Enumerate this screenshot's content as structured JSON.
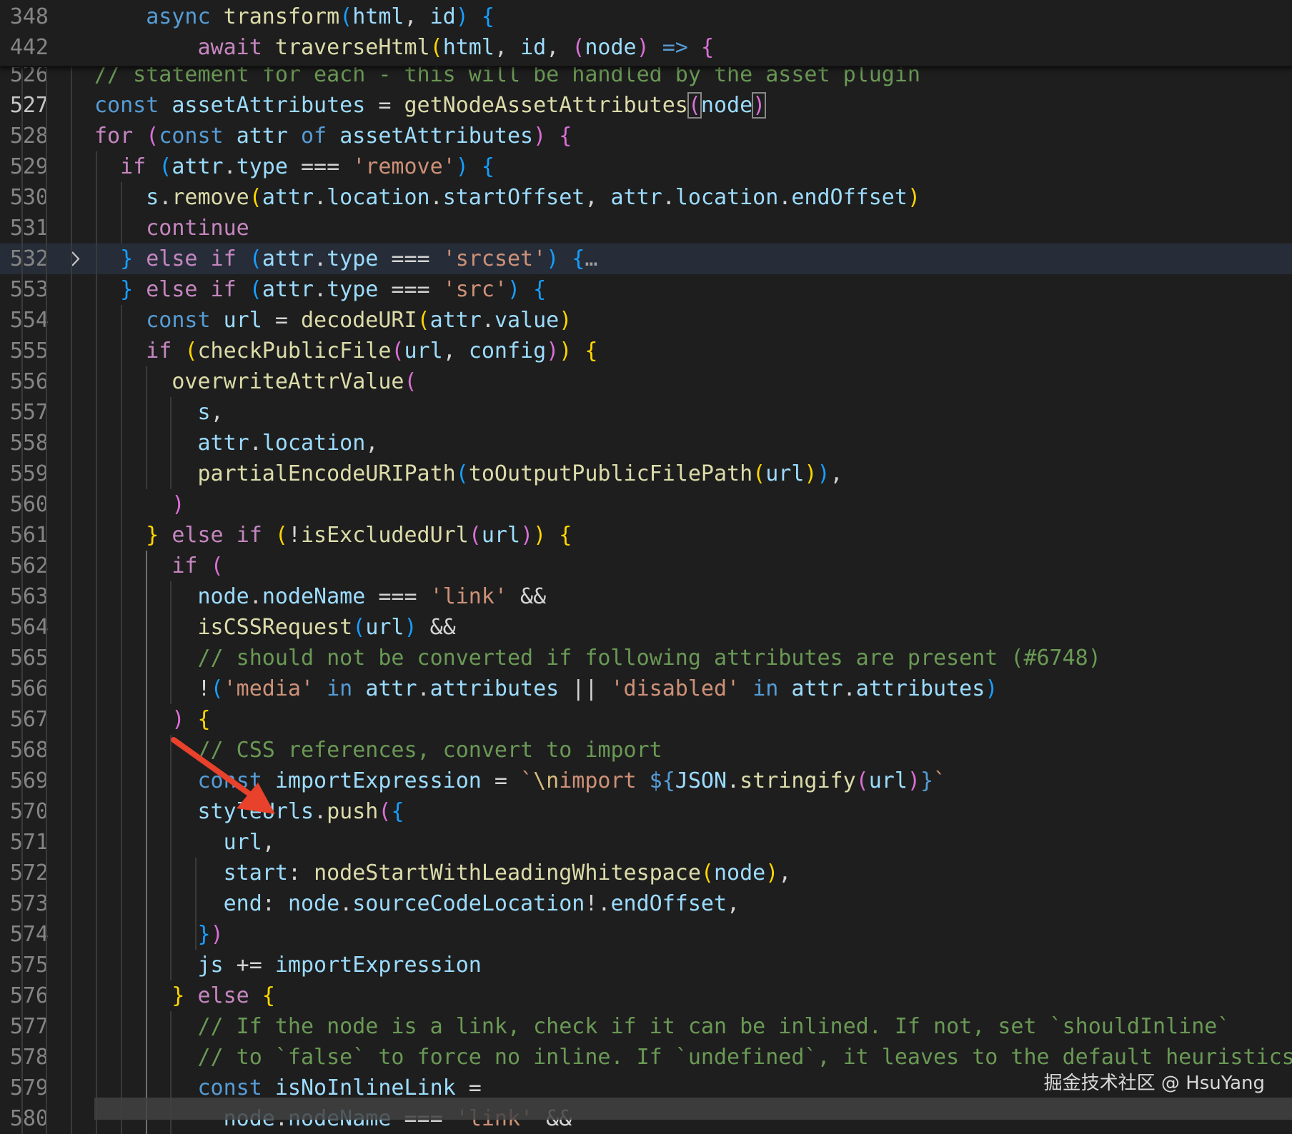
{
  "sticky": [
    {
      "ln": "348",
      "tokens": [
        [
          "    ",
          "op"
        ],
        [
          "async",
          "kw"
        ],
        [
          " ",
          "op"
        ],
        [
          "transform",
          "fn"
        ],
        [
          "(",
          "br3"
        ],
        [
          "html",
          "var"
        ],
        [
          ", ",
          "op"
        ],
        [
          "id",
          "var"
        ],
        [
          ")",
          "br3"
        ],
        [
          " ",
          "op"
        ],
        [
          "{",
          "br3"
        ]
      ]
    },
    {
      "ln": "442",
      "tokens": [
        [
          "        ",
          "op"
        ],
        [
          "await",
          "ctl"
        ],
        [
          " ",
          "op"
        ],
        [
          "traverseHtml",
          "fn"
        ],
        [
          "(",
          "br1"
        ],
        [
          "html",
          "var"
        ],
        [
          ", ",
          "op"
        ],
        [
          "id",
          "var"
        ],
        [
          ", ",
          "op"
        ],
        [
          "(",
          "br2"
        ],
        [
          "node",
          "var"
        ],
        [
          ")",
          "br2"
        ],
        [
          " ",
          "op"
        ],
        [
          "=>",
          "kw"
        ],
        [
          " ",
          "op"
        ],
        [
          "{",
          "br2"
        ]
      ]
    }
  ],
  "lines": [
    {
      "ln": "526",
      "tokens": [
        [
          "// statement for each - this will be handled by the asset plugin",
          "cmt"
        ]
      ]
    },
    {
      "ln": "527",
      "active": true,
      "tokens": [
        [
          "const",
          "kw"
        ],
        [
          " ",
          "op"
        ],
        [
          "assetAttributes",
          "var"
        ],
        [
          " = ",
          "op"
        ],
        [
          "getNodeAssetAttributes",
          "fn"
        ],
        [
          "(",
          "br2",
          "box"
        ],
        [
          "node",
          "var"
        ],
        [
          ")",
          "br2",
          "box"
        ]
      ]
    },
    {
      "ln": "528",
      "tokens": [
        [
          "for",
          "ctl"
        ],
        [
          " ",
          "op"
        ],
        [
          "(",
          "br2"
        ],
        [
          "const",
          "kw"
        ],
        [
          " ",
          "op"
        ],
        [
          "attr",
          "var"
        ],
        [
          " ",
          "op"
        ],
        [
          "of",
          "kw"
        ],
        [
          " ",
          "op"
        ],
        [
          "assetAttributes",
          "var"
        ],
        [
          ")",
          "br2"
        ],
        [
          " ",
          "op"
        ],
        [
          "{",
          "br2"
        ]
      ]
    },
    {
      "ln": "529",
      "tokens": [
        [
          "  ",
          "op"
        ],
        [
          "if",
          "ctl"
        ],
        [
          " ",
          "op"
        ],
        [
          "(",
          "br3"
        ],
        [
          "attr",
          "var"
        ],
        [
          ".",
          "op"
        ],
        [
          "type",
          "var"
        ],
        [
          " === ",
          "op"
        ],
        [
          "'remove'",
          "str"
        ],
        [
          ")",
          "br3"
        ],
        [
          " ",
          "op"
        ],
        [
          "{",
          "br3"
        ]
      ]
    },
    {
      "ln": "530",
      "tokens": [
        [
          "    ",
          "op"
        ],
        [
          "s",
          "var"
        ],
        [
          ".",
          "op"
        ],
        [
          "remove",
          "fn"
        ],
        [
          "(",
          "br1"
        ],
        [
          "attr",
          "var"
        ],
        [
          ".",
          "op"
        ],
        [
          "location",
          "var"
        ],
        [
          ".",
          "op"
        ],
        [
          "startOffset",
          "var"
        ],
        [
          ", ",
          "op"
        ],
        [
          "attr",
          "var"
        ],
        [
          ".",
          "op"
        ],
        [
          "location",
          "var"
        ],
        [
          ".",
          "op"
        ],
        [
          "endOffset",
          "var"
        ],
        [
          ")",
          "br1"
        ]
      ]
    },
    {
      "ln": "531",
      "tokens": [
        [
          "    ",
          "op"
        ],
        [
          "continue",
          "ctl"
        ]
      ]
    },
    {
      "ln": "532",
      "folded": true,
      "tokens": [
        [
          "  ",
          "op"
        ],
        [
          "}",
          "br3"
        ],
        [
          " ",
          "op"
        ],
        [
          "else",
          "ctl"
        ],
        [
          " ",
          "op"
        ],
        [
          "if",
          "ctl"
        ],
        [
          " ",
          "op"
        ],
        [
          "(",
          "br3"
        ],
        [
          "attr",
          "var"
        ],
        [
          ".",
          "op"
        ],
        [
          "type",
          "var"
        ],
        [
          " === ",
          "op"
        ],
        [
          "'srcset'",
          "str"
        ],
        [
          ")",
          "br3"
        ],
        [
          " ",
          "op"
        ],
        [
          "{",
          "br3"
        ],
        [
          "…",
          "ell"
        ]
      ]
    },
    {
      "ln": "553",
      "tokens": [
        [
          "  ",
          "op"
        ],
        [
          "}",
          "br3"
        ],
        [
          " ",
          "op"
        ],
        [
          "else",
          "ctl"
        ],
        [
          " ",
          "op"
        ],
        [
          "if",
          "ctl"
        ],
        [
          " ",
          "op"
        ],
        [
          "(",
          "br3"
        ],
        [
          "attr",
          "var"
        ],
        [
          ".",
          "op"
        ],
        [
          "type",
          "var"
        ],
        [
          " === ",
          "op"
        ],
        [
          "'src'",
          "str"
        ],
        [
          ")",
          "br3"
        ],
        [
          " ",
          "op"
        ],
        [
          "{",
          "br3"
        ]
      ]
    },
    {
      "ln": "554",
      "tokens": [
        [
          "    ",
          "op"
        ],
        [
          "const",
          "kw"
        ],
        [
          " ",
          "op"
        ],
        [
          "url",
          "var"
        ],
        [
          " = ",
          "op"
        ],
        [
          "decodeURI",
          "fn"
        ],
        [
          "(",
          "br1"
        ],
        [
          "attr",
          "var"
        ],
        [
          ".",
          "op"
        ],
        [
          "value",
          "var"
        ],
        [
          ")",
          "br1"
        ]
      ]
    },
    {
      "ln": "555",
      "tokens": [
        [
          "    ",
          "op"
        ],
        [
          "if",
          "ctl"
        ],
        [
          " ",
          "op"
        ],
        [
          "(",
          "br1"
        ],
        [
          "checkPublicFile",
          "fn"
        ],
        [
          "(",
          "br2"
        ],
        [
          "url",
          "var"
        ],
        [
          ", ",
          "op"
        ],
        [
          "config",
          "var"
        ],
        [
          ")",
          "br2"
        ],
        [
          ")",
          "br1"
        ],
        [
          " ",
          "op"
        ],
        [
          "{",
          "br1"
        ]
      ]
    },
    {
      "ln": "556",
      "tokens": [
        [
          "      ",
          "op"
        ],
        [
          "overwriteAttrValue",
          "fn"
        ],
        [
          "(",
          "br2"
        ]
      ]
    },
    {
      "ln": "557",
      "tokens": [
        [
          "        ",
          "op"
        ],
        [
          "s",
          "var"
        ],
        [
          ",",
          "op"
        ]
      ]
    },
    {
      "ln": "558",
      "tokens": [
        [
          "        ",
          "op"
        ],
        [
          "attr",
          "var"
        ],
        [
          ".",
          "op"
        ],
        [
          "location",
          "var"
        ],
        [
          ",",
          "op"
        ]
      ]
    },
    {
      "ln": "559",
      "tokens": [
        [
          "        ",
          "op"
        ],
        [
          "partialEncodeURIPath",
          "fn"
        ],
        [
          "(",
          "br3"
        ],
        [
          "toOutputPublicFilePath",
          "fn"
        ],
        [
          "(",
          "br1"
        ],
        [
          "url",
          "var"
        ],
        [
          ")",
          "br1"
        ],
        [
          ")",
          "br3"
        ],
        [
          ",",
          "op"
        ]
      ]
    },
    {
      "ln": "560",
      "tokens": [
        [
          "      ",
          "op"
        ],
        [
          ")",
          "br2"
        ]
      ]
    },
    {
      "ln": "561",
      "tokens": [
        [
          "    ",
          "op"
        ],
        [
          "}",
          "br1"
        ],
        [
          " ",
          "op"
        ],
        [
          "else",
          "ctl"
        ],
        [
          " ",
          "op"
        ],
        [
          "if",
          "ctl"
        ],
        [
          " ",
          "op"
        ],
        [
          "(",
          "br1"
        ],
        [
          "!",
          "op"
        ],
        [
          "isExcludedUrl",
          "fn"
        ],
        [
          "(",
          "br2"
        ],
        [
          "url",
          "var"
        ],
        [
          ")",
          "br2"
        ],
        [
          ")",
          "br1"
        ],
        [
          " ",
          "op"
        ],
        [
          "{",
          "br1"
        ]
      ]
    },
    {
      "ln": "562",
      "tokens": [
        [
          "      ",
          "op"
        ],
        [
          "if",
          "ctl"
        ],
        [
          " ",
          "op"
        ],
        [
          "(",
          "br2"
        ]
      ]
    },
    {
      "ln": "563",
      "tokens": [
        [
          "        ",
          "op"
        ],
        [
          "node",
          "var"
        ],
        [
          ".",
          "op"
        ],
        [
          "nodeName",
          "var"
        ],
        [
          " === ",
          "op"
        ],
        [
          "'link'",
          "str"
        ],
        [
          " &&",
          "op"
        ]
      ]
    },
    {
      "ln": "564",
      "tokens": [
        [
          "        ",
          "op"
        ],
        [
          "isCSSRequest",
          "fn"
        ],
        [
          "(",
          "br3"
        ],
        [
          "url",
          "var"
        ],
        [
          ")",
          "br3"
        ],
        [
          " &&",
          "op"
        ]
      ]
    },
    {
      "ln": "565",
      "tokens": [
        [
          "        ",
          "op"
        ],
        [
          "// should not be converted if following attributes are present (#6748)",
          "cmt"
        ]
      ]
    },
    {
      "ln": "566",
      "tokens": [
        [
          "        ",
          "op"
        ],
        [
          "!",
          "op"
        ],
        [
          "(",
          "br3"
        ],
        [
          "'media'",
          "str"
        ],
        [
          " ",
          "op"
        ],
        [
          "in",
          "kw"
        ],
        [
          " ",
          "op"
        ],
        [
          "attr",
          "var"
        ],
        [
          ".",
          "op"
        ],
        [
          "attributes",
          "var"
        ],
        [
          " || ",
          "op"
        ],
        [
          "'disabled'",
          "str"
        ],
        [
          " ",
          "op"
        ],
        [
          "in",
          "kw"
        ],
        [
          " ",
          "op"
        ],
        [
          "attr",
          "var"
        ],
        [
          ".",
          "op"
        ],
        [
          "attributes",
          "var"
        ],
        [
          ")",
          "br3"
        ]
      ]
    },
    {
      "ln": "567",
      "tokens": [
        [
          "      ",
          "op"
        ],
        [
          ")",
          "br2"
        ],
        [
          " ",
          "op"
        ],
        [
          "{",
          "br1"
        ]
      ]
    },
    {
      "ln": "568",
      "tokens": [
        [
          "        ",
          "op"
        ],
        [
          "// CSS references, convert to import",
          "cmt"
        ]
      ]
    },
    {
      "ln": "569",
      "tokens": [
        [
          "        ",
          "op"
        ],
        [
          "const",
          "kw"
        ],
        [
          " ",
          "op"
        ],
        [
          "importExpression",
          "var"
        ],
        [
          " = ",
          "op"
        ],
        [
          "`",
          "str"
        ],
        [
          "\\n",
          "esc"
        ],
        [
          "import ",
          "str"
        ],
        [
          "${",
          "kw"
        ],
        [
          "JSON",
          "var"
        ],
        [
          ".",
          "op"
        ],
        [
          "stringify",
          "fn"
        ],
        [
          "(",
          "br2"
        ],
        [
          "url",
          "var"
        ],
        [
          ")",
          "br2"
        ],
        [
          "}",
          "kw"
        ],
        [
          "`",
          "str"
        ]
      ]
    },
    {
      "ln": "570",
      "tokens": [
        [
          "        ",
          "op"
        ],
        [
          "styleUrls",
          "var"
        ],
        [
          ".",
          "op"
        ],
        [
          "push",
          "fn"
        ],
        [
          "(",
          "br2"
        ],
        [
          "{",
          "br3"
        ]
      ]
    },
    {
      "ln": "571",
      "tokens": [
        [
          "          ",
          "op"
        ],
        [
          "url",
          "var"
        ],
        [
          ",",
          "op"
        ]
      ]
    },
    {
      "ln": "572",
      "tokens": [
        [
          "          ",
          "op"
        ],
        [
          "start",
          "var"
        ],
        [
          ": ",
          "op"
        ],
        [
          "nodeStartWithLeadingWhitespace",
          "fn"
        ],
        [
          "(",
          "br1"
        ],
        [
          "node",
          "var"
        ],
        [
          ")",
          "br1"
        ],
        [
          ",",
          "op"
        ]
      ]
    },
    {
      "ln": "573",
      "tokens": [
        [
          "          ",
          "op"
        ],
        [
          "end",
          "var"
        ],
        [
          ": ",
          "op"
        ],
        [
          "node",
          "var"
        ],
        [
          ".",
          "op"
        ],
        [
          "sourceCodeLocation",
          "var"
        ],
        [
          "!.",
          "op"
        ],
        [
          "endOffset",
          "var"
        ],
        [
          ",",
          "op"
        ]
      ]
    },
    {
      "ln": "574",
      "tokens": [
        [
          "        ",
          "op"
        ],
        [
          "}",
          "br3"
        ],
        [
          ")",
          "br2"
        ]
      ]
    },
    {
      "ln": "575",
      "tokens": [
        [
          "        ",
          "op"
        ],
        [
          "js",
          "var"
        ],
        [
          " += ",
          "op"
        ],
        [
          "importExpression",
          "var"
        ]
      ]
    },
    {
      "ln": "576",
      "tokens": [
        [
          "      ",
          "op"
        ],
        [
          "}",
          "br1"
        ],
        [
          " ",
          "op"
        ],
        [
          "else",
          "ctl"
        ],
        [
          " ",
          "op"
        ],
        [
          "{",
          "br1"
        ]
      ]
    },
    {
      "ln": "577",
      "tokens": [
        [
          "        ",
          "op"
        ],
        [
          "// If the node is a link, check if it can be inlined. If not, set `shouldInline`",
          "cmt"
        ]
      ]
    },
    {
      "ln": "578",
      "tokens": [
        [
          "        ",
          "op"
        ],
        [
          "// to `false` to force no inline. If `undefined`, it leaves to the default heuristics",
          "cmt"
        ]
      ]
    },
    {
      "ln": "579",
      "tokens": [
        [
          "        ",
          "op"
        ],
        [
          "const",
          "kw"
        ],
        [
          " ",
          "op"
        ],
        [
          "isNoInlineLink",
          "var"
        ],
        [
          " =",
          "op"
        ]
      ]
    },
    {
      "ln": "580",
      "tokens": [
        [
          "          ",
          "op"
        ],
        [
          "node",
          "var"
        ],
        [
          ".",
          "op"
        ],
        [
          "nodeName",
          "var"
        ],
        [
          " === ",
          "op"
        ],
        [
          "'link'",
          "str"
        ],
        [
          " &&",
          "op"
        ]
      ]
    }
  ],
  "watermark": "掘金技术社区 @ HsuYang",
  "colors": {
    "background": "#1e1e1e",
    "highlight_line": "#262d38",
    "keyword": "#569cd6",
    "control": "#c586c0",
    "function": "#dcdcaa",
    "variable": "#9cdcfe",
    "string": "#ce9178",
    "comment": "#6a9955",
    "arrow": "#e8412c"
  },
  "icons": {
    "fold": "chevron-right-icon",
    "annotation": "red-arrow-icon"
  }
}
